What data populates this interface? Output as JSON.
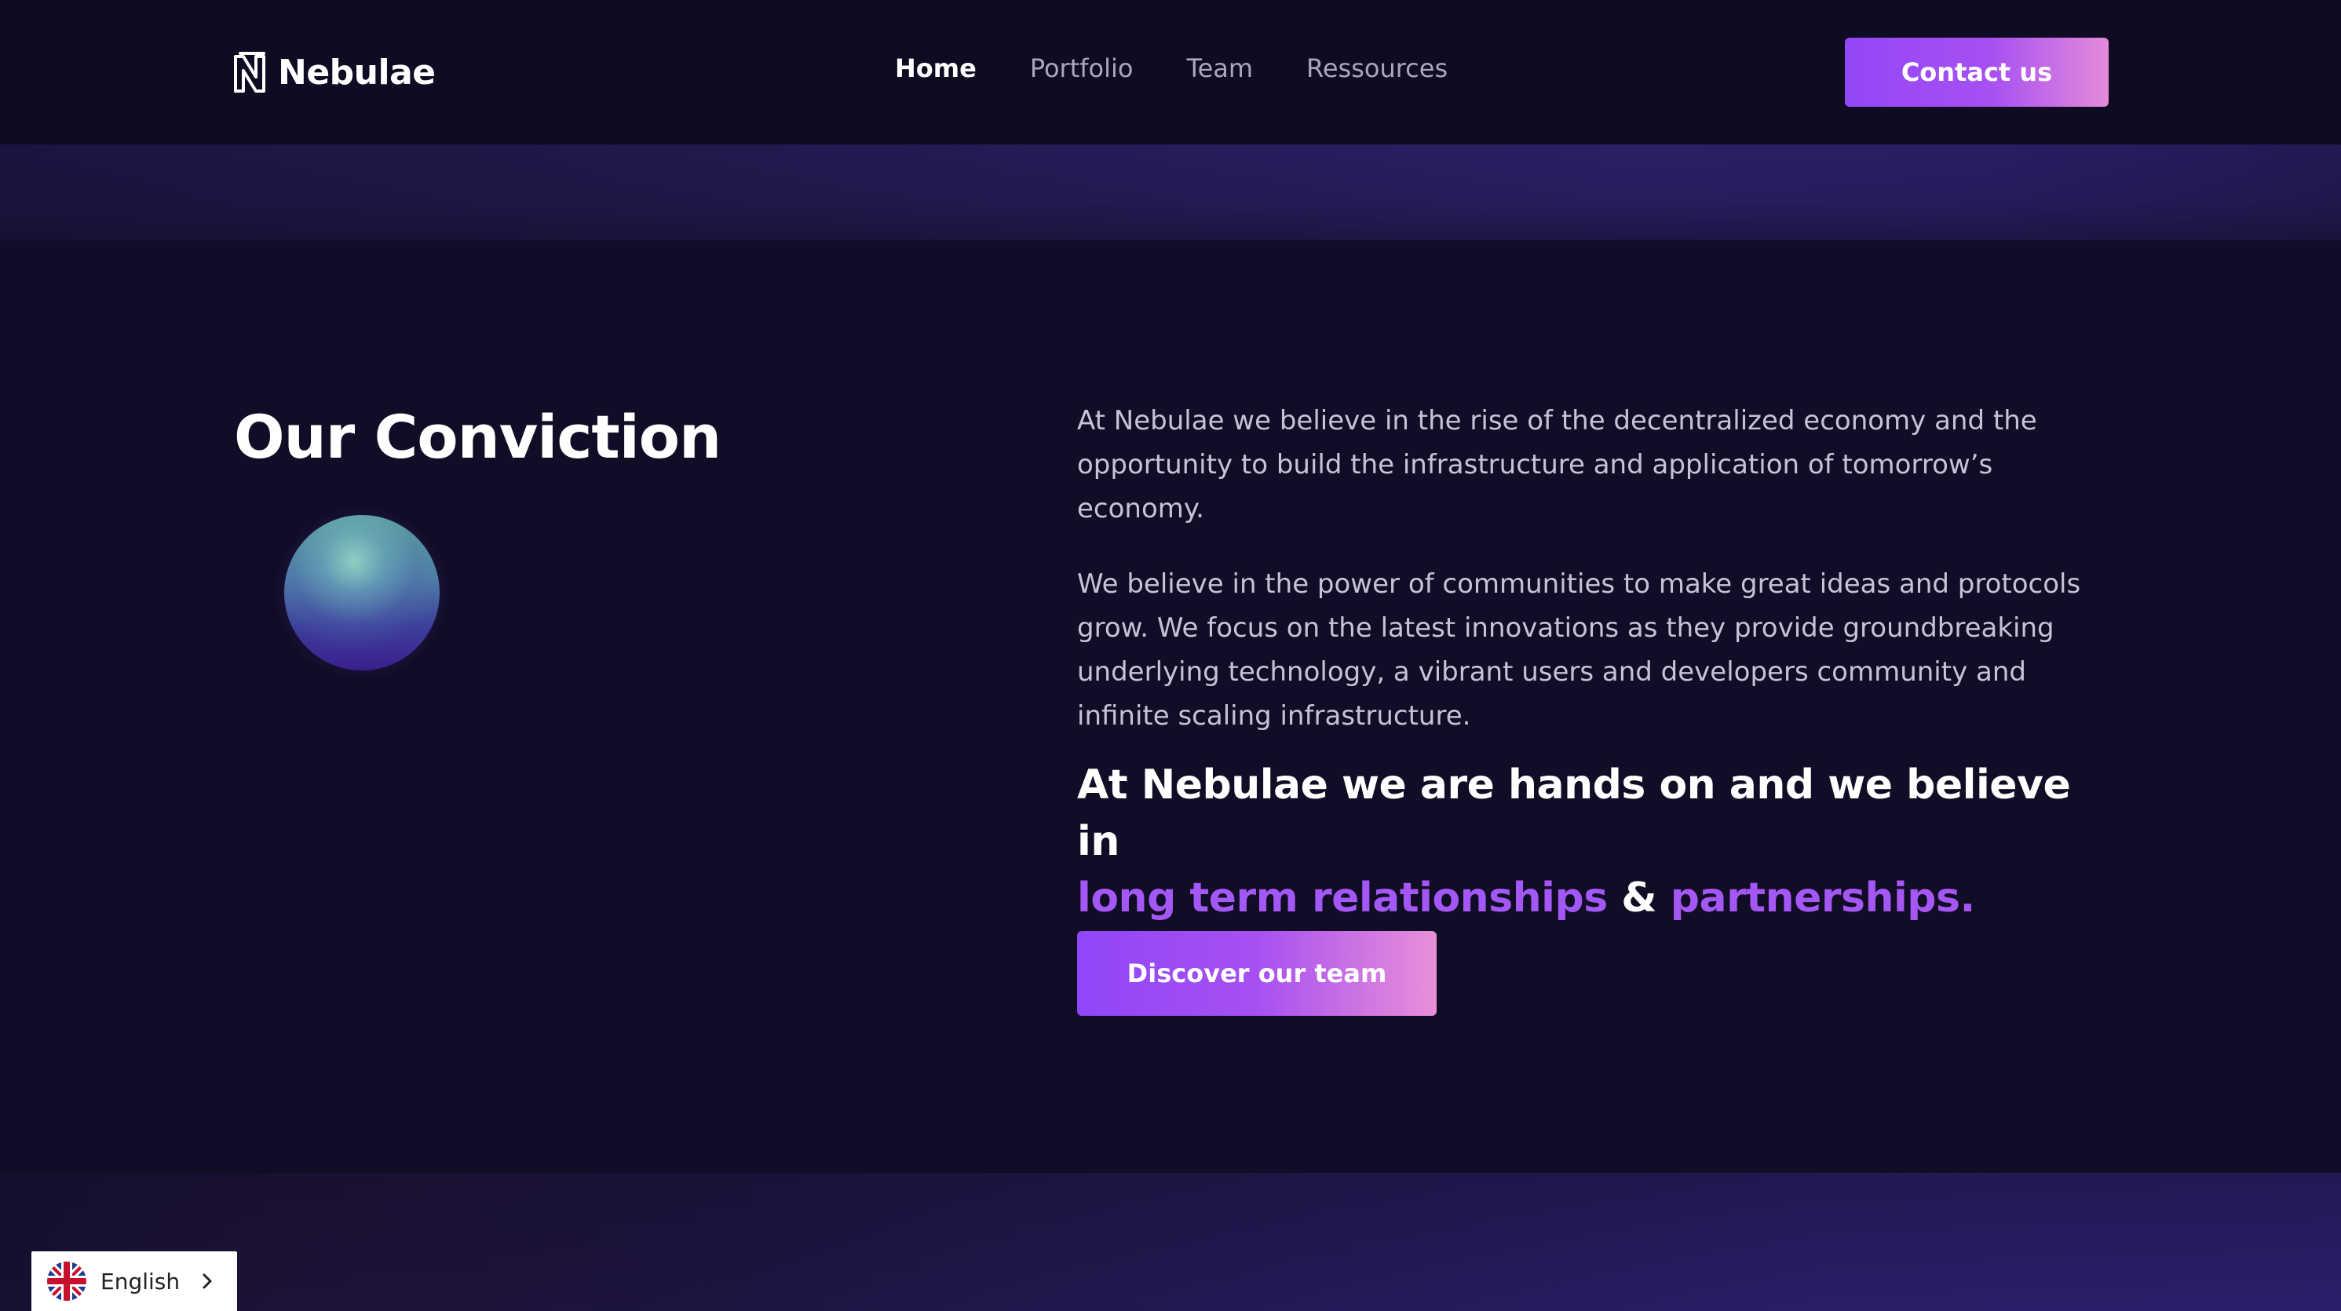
{
  "header": {
    "brand_name": "Nebulae",
    "nav": [
      {
        "label": "Home",
        "active": true
      },
      {
        "label": "Portfolio",
        "active": false
      },
      {
        "label": "Team",
        "active": false
      },
      {
        "label": "Ressources",
        "active": false
      }
    ],
    "contact_label": "Contact us"
  },
  "conviction": {
    "title": "Our Conviction",
    "paragraphs": [
      "At Nebulae we believe in the rise of the decentralized economy and the opportunity to build the infrastructure and application of tomorrow’s economy.",
      "We believe in the power of communities to make great ideas and protocols grow. We focus on the latest innovations as they provide  groundbreaking underlying technology, a vibrant users and developers community and infinite scaling infrastructure."
    ],
    "statement": {
      "lead": "At Nebulae we are hands on and we believe in",
      "highlight_1": "long term relationships",
      "connector": "&",
      "highlight_2": "partnerships."
    },
    "cta_label": "Discover our team"
  },
  "language": {
    "label": "English",
    "flag_icon": "uk-flag-icon"
  },
  "colors": {
    "background": "#110d26",
    "accent_purple": "#9447f8",
    "accent_pink": "#e58ada",
    "highlight_text": "#a357f5"
  }
}
